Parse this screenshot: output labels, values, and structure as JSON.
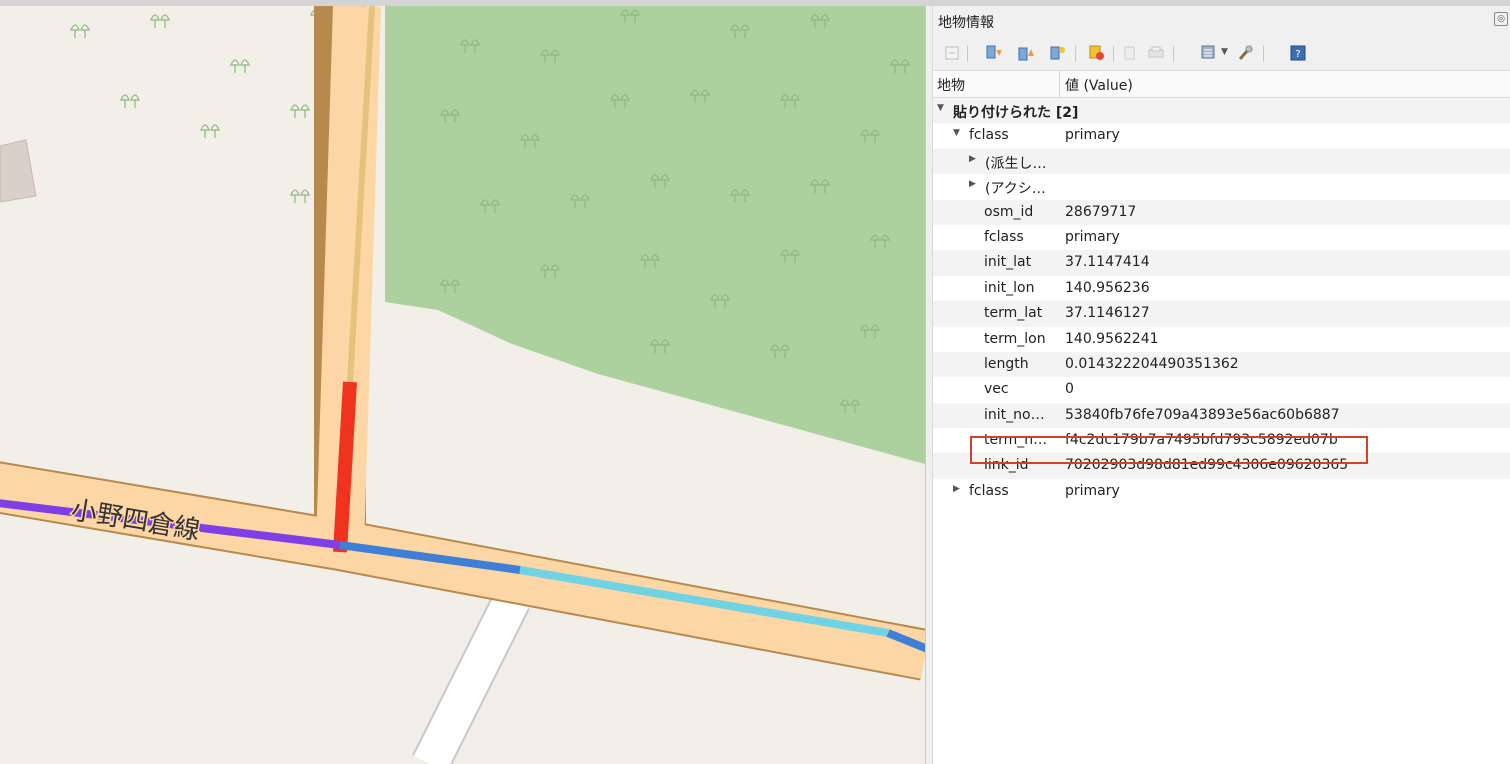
{
  "map": {
    "road_label": "小野四倉線",
    "colors": {
      "background": "#f2efe9",
      "forest": "#add19e",
      "road_fill": "#fcd6a4",
      "road_casing": "#b58a4c",
      "selected_segment": "#f0331f",
      "purple_line": "#7f3fe6",
      "blue_line": "#3f7fd6",
      "cyan_line": "#6fd3e4"
    }
  },
  "panel": {
    "title": "地物情報",
    "columns": {
      "feature": "地物",
      "value": "値 (Value)"
    },
    "rows": [
      {
        "key": "貼り付けられた [2]",
        "value": ""
      },
      {
        "key": "fclass",
        "value": "primary"
      },
      {
        "key": "(派生し…",
        "value": ""
      },
      {
        "key": "(アクシ…",
        "value": ""
      },
      {
        "key": "osm_id",
        "value": "28679717"
      },
      {
        "key": "fclass",
        "value": "primary"
      },
      {
        "key": "init_lat",
        "value": "37.1147414"
      },
      {
        "key": "init_lon",
        "value": "140.956236"
      },
      {
        "key": "term_lat",
        "value": "37.1146127"
      },
      {
        "key": "term_lon",
        "value": "140.9562241"
      },
      {
        "key": "length",
        "value": "0.014322204490351362"
      },
      {
        "key": "vec",
        "value": "0"
      },
      {
        "key": "init_no…",
        "value": "53840fb76fe709a43893e56ac60b6887"
      },
      {
        "key": "term_n…",
        "value": "f4c2dc179b7a7495bfd793c5892ed07b"
      },
      {
        "key": "link_id",
        "value": "70202903d98d81ed99c4306e09620365"
      },
      {
        "key": "fclass",
        "value": "primary"
      }
    ],
    "highlight_color": "#d0432a"
  }
}
